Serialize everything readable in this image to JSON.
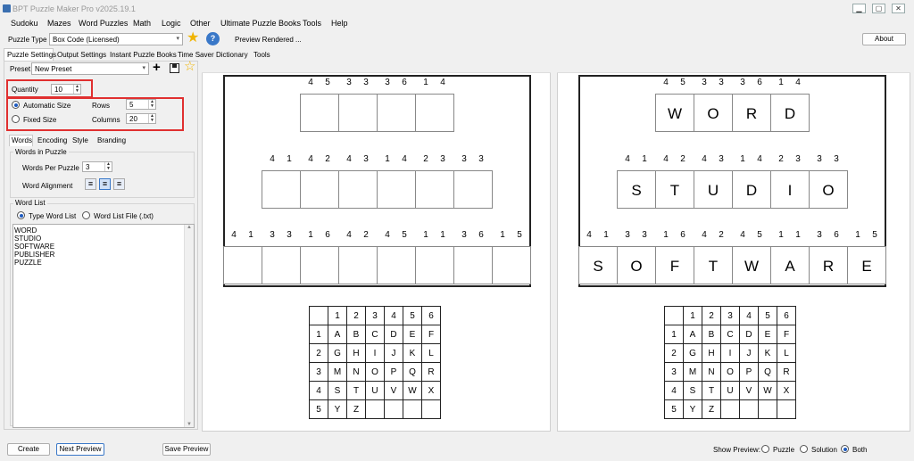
{
  "window": {
    "title": "BPT Puzzle Maker Pro v2025.19.1"
  },
  "menu": [
    "Sudoku",
    "Mazes",
    "Word Puzzles",
    "Math",
    "Logic",
    "Other",
    "Ultimate Puzzle Books",
    "Tools",
    "Help"
  ],
  "toolbar": {
    "puzzle_type_label": "Puzzle Type",
    "puzzle_type_value": "Box Code (Licensed)",
    "status_text": "Preview Rendered ...",
    "about_label": "About"
  },
  "tabs": [
    "Puzzle Settings",
    "Output Settings",
    "Instant Puzzle Books",
    "Time Saver",
    "Dictionary",
    "Tools"
  ],
  "preset": {
    "label": "Preset",
    "value": "New Preset"
  },
  "settings": {
    "quantity_label": "Quantity",
    "quantity_value": "10",
    "automatic_size_label": "Automatic Size",
    "fixed_size_label": "Fixed Size",
    "rows_label": "Rows",
    "rows_value": "5",
    "columns_label": "Columns",
    "columns_value": "20"
  },
  "subtabs": [
    "Words",
    "Encoding",
    "Style",
    "Branding"
  ],
  "words_in_puzzle": {
    "group_label": "Words in Puzzle",
    "words_per_puzzle_label": "Words Per Puzzle",
    "words_per_puzzle_value": "3",
    "word_alignment_label": "Word Alignment"
  },
  "word_list": {
    "group_label": "Word List",
    "type_word_list_label": "Type Word List",
    "word_list_file_label": "Word List File (.txt)",
    "words": [
      "WORD",
      "STUDIO",
      "SOFTWARE",
      "PUBLISHER",
      "PUZZLE"
    ]
  },
  "puzzle": {
    "rows": [
      {
        "codes": [
          "4",
          "5",
          "3",
          "3",
          "3",
          "6",
          "1",
          "4"
        ],
        "letters": [
          "W",
          "O",
          "R",
          "D"
        ]
      },
      {
        "codes": [
          "4",
          "1",
          "4",
          "2",
          "4",
          "3",
          "1",
          "4",
          "2",
          "3",
          "3",
          "3"
        ],
        "letters": [
          "S",
          "T",
          "U",
          "D",
          "I",
          "O"
        ]
      },
      {
        "codes": [
          "4",
          "1",
          "3",
          "3",
          "1",
          "6",
          "4",
          "2",
          "4",
          "5",
          "1",
          "1",
          "3",
          "6",
          "1",
          "5"
        ],
        "letters": [
          "S",
          "O",
          "F",
          "T",
          "W",
          "A",
          "R",
          "E"
        ]
      }
    ],
    "key_header": [
      "",
      "1",
      "2",
      "3",
      "4",
      "5",
      "6"
    ],
    "key_rows": [
      [
        "1",
        "A",
        "B",
        "C",
        "D",
        "E",
        "F"
      ],
      [
        "2",
        "G",
        "H",
        "I",
        "J",
        "K",
        "L"
      ],
      [
        "3",
        "M",
        "N",
        "O",
        "P",
        "Q",
        "R"
      ],
      [
        "4",
        "S",
        "T",
        "U",
        "V",
        "W",
        "X"
      ],
      [
        "5",
        "Y",
        "Z",
        "",
        "",
        "",
        ""
      ]
    ]
  },
  "bottom": {
    "create_label": "Create",
    "next_preview_label": "Next Preview",
    "save_preview_label": "Save Preview",
    "show_preview_label": "Show Preview:",
    "preview_options": [
      "Puzzle",
      "Solution",
      "Both"
    ],
    "preview_selected": "Both"
  },
  "colors": {
    "accent": "#1f5bbf",
    "highlight": "#e03030",
    "star": "#f0b400",
    "help": "#3a78c8"
  }
}
